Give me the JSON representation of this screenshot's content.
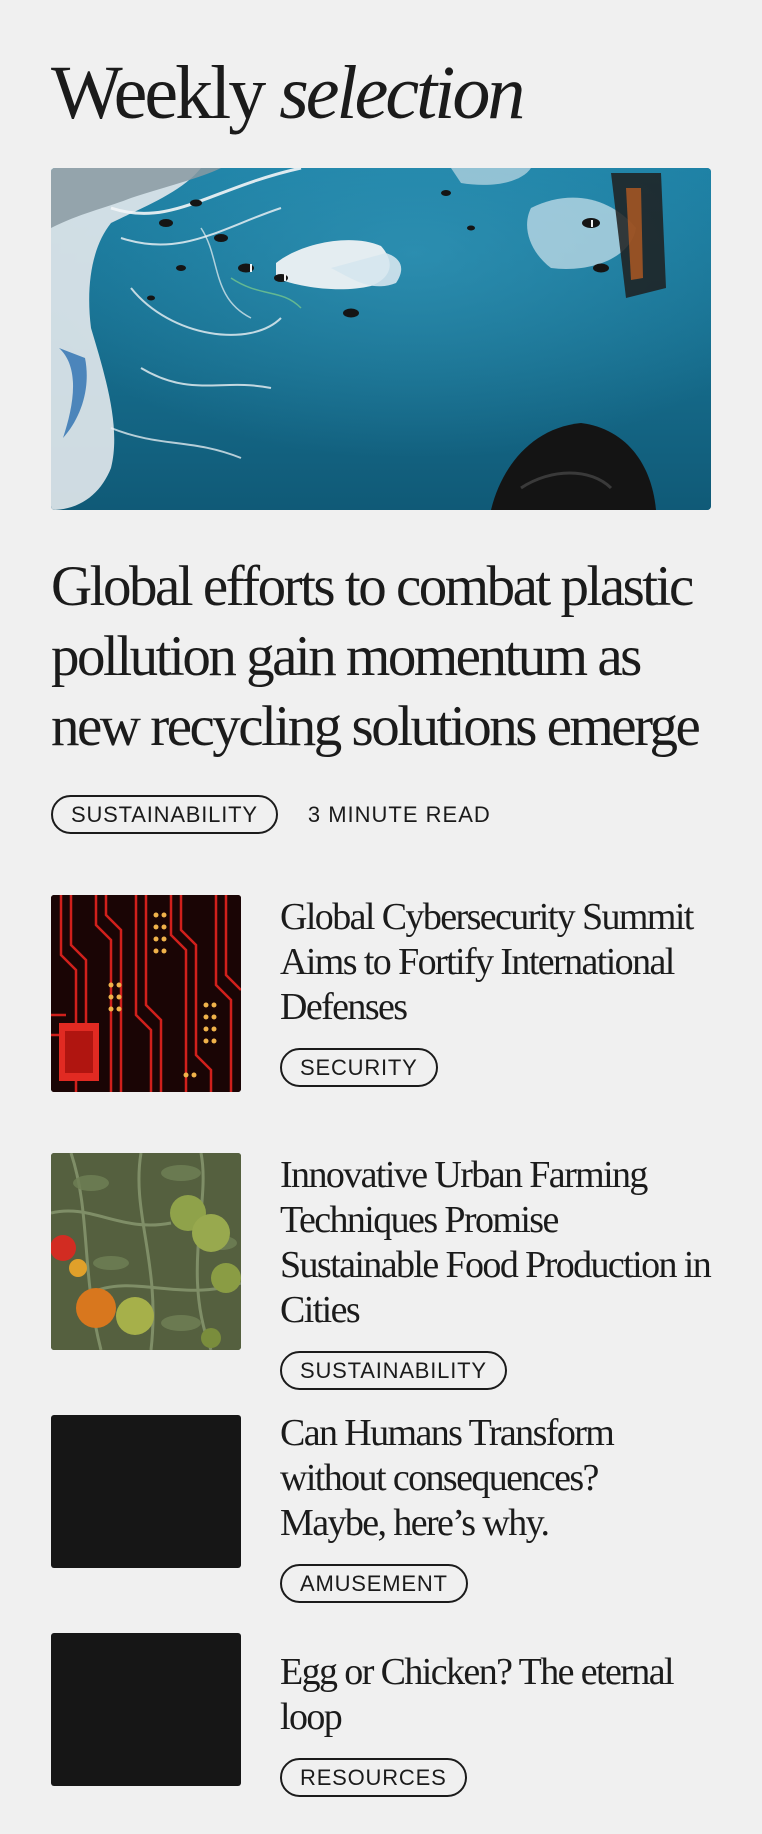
{
  "section": {
    "title_regular": "Weekly",
    "title_italic": "selection"
  },
  "featured": {
    "image_alt": "Plastic waste and fish floating underwater",
    "title": "Global efforts to combat plastic pollution gain momentum as new recycling solutions emerge",
    "tag": "SUSTAINABILITY",
    "read_time": "3 MINUTE READ"
  },
  "articles": [
    {
      "title": "Global Cybersecurity Summit Aims to Fortify International Defenses",
      "tag": "SECURITY",
      "thumbnail": "circuit-board-image"
    },
    {
      "title": "Innovative Urban Farming Techniques Promise Sustainable Food Production in Cities",
      "tag": "SUSTAINABILITY",
      "thumbnail": "tomato-plant-image"
    },
    {
      "title": "Can Humans Transform without consequences? Maybe, here’s why.",
      "tag": "AMUSEMENT",
      "thumbnail": "placeholder-dark"
    },
    {
      "title": "Egg or Chicken? The eternal loop",
      "tag": "RESOURCES",
      "thumbnail": "placeholder-dark"
    }
  ],
  "colors": {
    "background": "#f0f0f0",
    "text": "#1b1b1b",
    "thumbnail_placeholder": "#161616",
    "ocean": "#1b6d8d"
  }
}
